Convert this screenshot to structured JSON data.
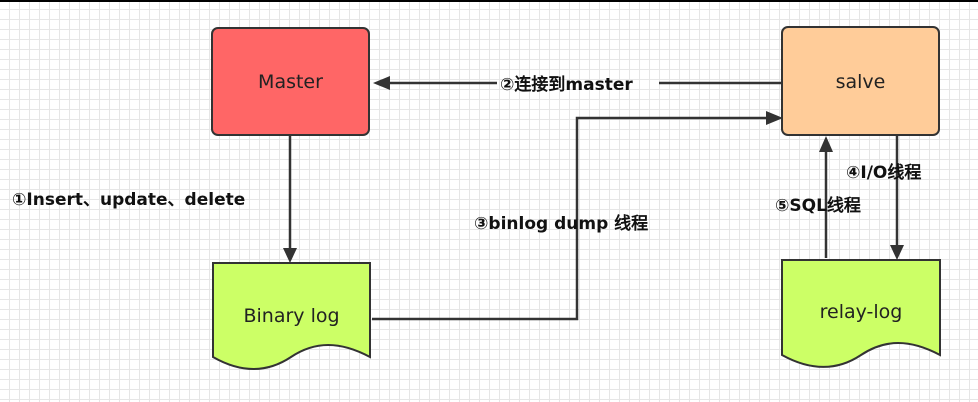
{
  "nodes": {
    "master": {
      "label": "Master",
      "color": "#ff6666"
    },
    "salve": {
      "label": "salve",
      "color": "#ffcc99"
    },
    "binary_log": {
      "label": "Binary log",
      "color": "#ccff66"
    },
    "relay_log": {
      "label": "relay-log",
      "color": "#ccff66"
    }
  },
  "edges": {
    "step1": {
      "label": "①Insert、update、delete"
    },
    "step2": {
      "label": "②连接到master"
    },
    "step3": {
      "label": "③binlog dump 线程"
    },
    "step4": {
      "label": "④I/O线程"
    },
    "step5": {
      "label": "⑤SQL线程"
    }
  }
}
